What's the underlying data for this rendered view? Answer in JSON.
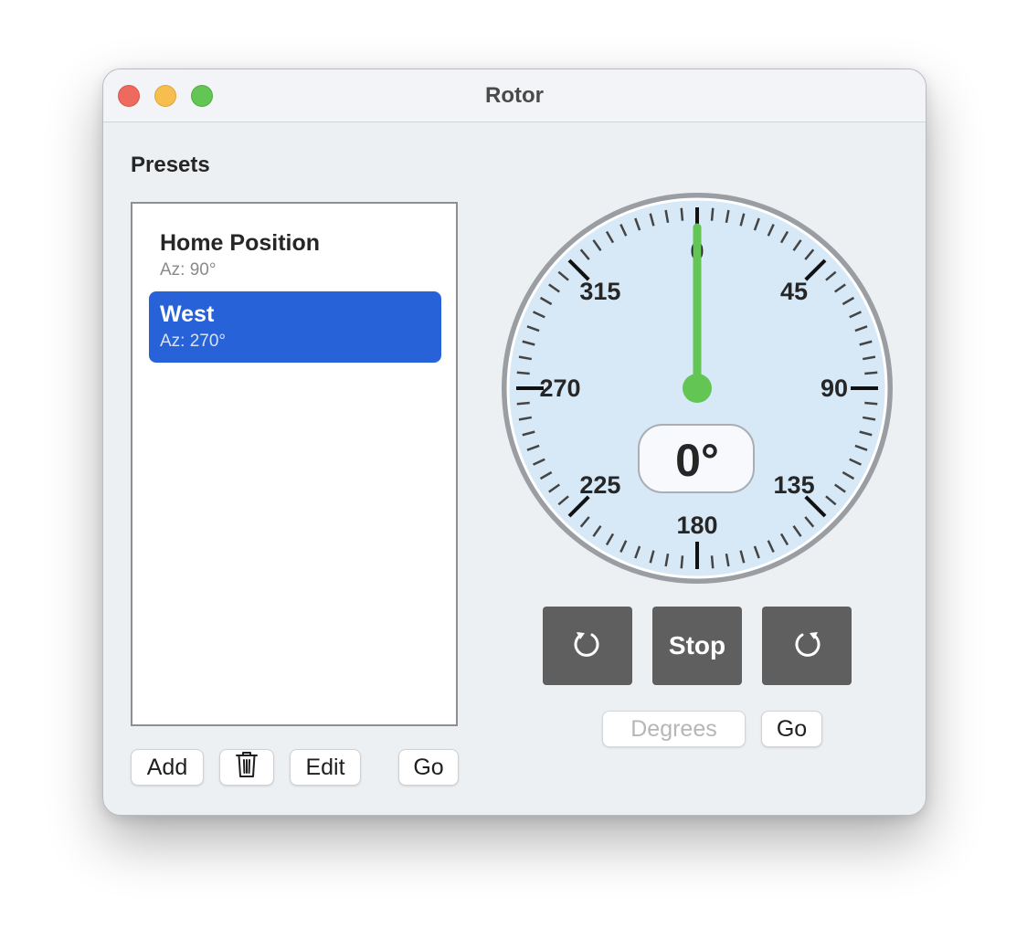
{
  "window": {
    "title": "Rotor",
    "controls": [
      "close",
      "minimize",
      "zoom"
    ]
  },
  "presets": {
    "title": "Presets",
    "items": [
      {
        "name": "Home Position",
        "azimuth": "Az: 90°",
        "selected": false
      },
      {
        "name": "West",
        "azimuth": "Az: 270°",
        "selected": true
      }
    ],
    "buttons": {
      "add": "Add",
      "delete_icon": "trash-icon",
      "edit": "Edit",
      "go": "Go"
    }
  },
  "dial": {
    "current_azimuth": 0,
    "readout": "0°",
    "labels": [
      "0",
      "45",
      "90",
      "135",
      "180",
      "225",
      "270",
      "315"
    ],
    "needle_color": "#62c554",
    "face_color": "#d7e8f6"
  },
  "controls": {
    "ccw_icon": "rotate-counterclockwise-icon",
    "stop_label": "Stop",
    "cw_icon": "rotate-clockwise-icon",
    "degrees_placeholder": "Degrees",
    "degrees_value": "",
    "go_label": "Go"
  },
  "colors": {
    "selection": "#2762d9",
    "control_button": "#5f5f5f",
    "window_bg": "#edf0f3"
  }
}
